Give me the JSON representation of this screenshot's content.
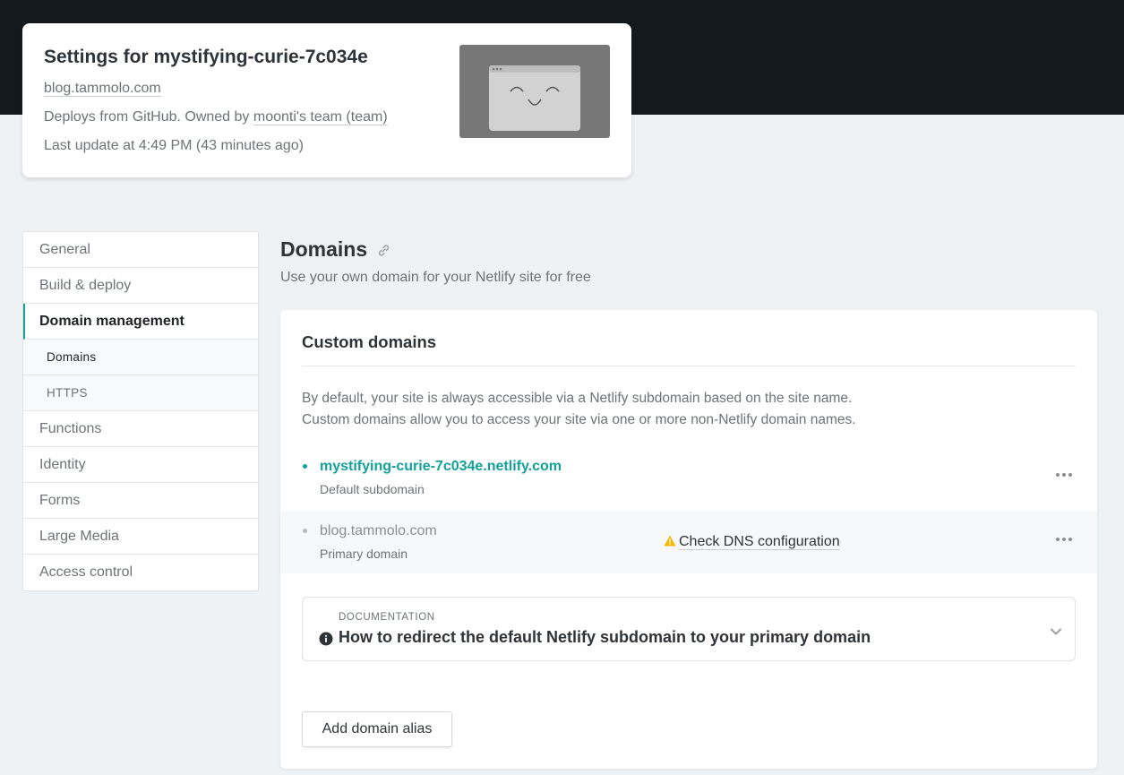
{
  "site": {
    "title": "Settings for mystifying-curie-7c034e",
    "domain_link": "blog.tammolo.com",
    "deploy_prefix": "Deploys from GitHub. Owned by ",
    "team_link": "moonti's team (team)",
    "last_update": "Last update at 4:49 PM (43 minutes ago)"
  },
  "sidebar": {
    "items": [
      {
        "label": "General"
      },
      {
        "label": "Build & deploy"
      },
      {
        "label": "Domain management",
        "active": true
      },
      {
        "label": "Domains",
        "sub": true,
        "active": true
      },
      {
        "label": "HTTPS",
        "sub": true
      },
      {
        "label": "Functions"
      },
      {
        "label": "Identity"
      },
      {
        "label": "Forms"
      },
      {
        "label": "Large Media"
      },
      {
        "label": "Access control"
      }
    ]
  },
  "main": {
    "title": "Domains",
    "description": "Use your own domain for your Netlify site for free",
    "custom_domains": {
      "title": "Custom domains",
      "text1": "By default, your site is always accessible via a Netlify subdomain based on the site name.",
      "text2": "Custom domains allow you to access your site via one or more non-Netlify domain names.",
      "domains": [
        {
          "name": "mystifying-curie-7c034e.netlify.com",
          "sub": "Default subdomain",
          "dot_color": "#12a19a"
        },
        {
          "name": "blog.tammolo.com",
          "sub": "Primary domain",
          "dot_color": "#b5b9bd",
          "warning": "Check DNS configuration"
        }
      ],
      "docs": {
        "eyebrow": "DOCUMENTATION",
        "title": "How to redirect the default Netlify subdomain to your primary domain"
      },
      "add_button": "Add domain alias"
    }
  },
  "colors": {
    "accent": "#12a19a",
    "warning": "#f5b800",
    "header_bg": "#121a20"
  },
  "icons": [
    "link-icon",
    "warning-icon",
    "info-icon",
    "chevron-down-icon",
    "more-icon",
    "browser-placeholder-icon"
  ]
}
